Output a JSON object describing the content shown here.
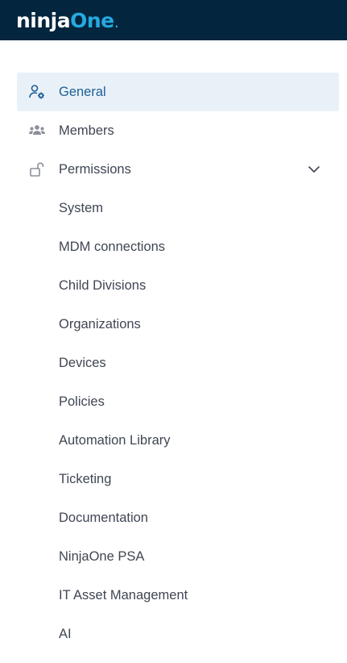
{
  "brand": {
    "ninja": "ninja",
    "one": "One",
    "dot": "."
  },
  "nav": {
    "general": {
      "label": "General"
    },
    "members": {
      "label": "Members"
    },
    "permissions": {
      "label": "Permissions"
    }
  },
  "permissions_items": [
    {
      "label": "System"
    },
    {
      "label": "MDM connections"
    },
    {
      "label": "Child Divisions"
    },
    {
      "label": "Organizations"
    },
    {
      "label": "Devices"
    },
    {
      "label": "Policies"
    },
    {
      "label": "Automation Library"
    },
    {
      "label": "Ticketing"
    },
    {
      "label": "Documentation"
    },
    {
      "label": "NinjaOne PSA"
    },
    {
      "label": "IT Asset Management"
    },
    {
      "label": "AI"
    }
  ],
  "colors": {
    "topbar": "#03253d",
    "brand_accent": "#26a9e0",
    "active_bg": "#e9f1f8",
    "active_text": "#1d5f95",
    "text": "#3f4653",
    "icon_gray": "#8a909a"
  }
}
